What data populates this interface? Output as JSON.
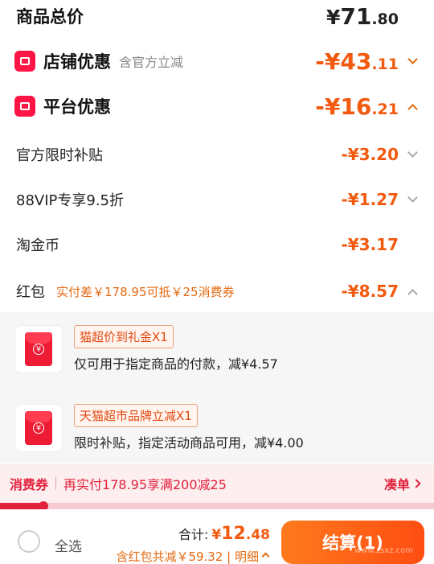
{
  "summary": {
    "total_label": "商品总价",
    "total_currency": "¥",
    "total_int": "71",
    "total_dec": ".80"
  },
  "store_discount": {
    "label": "店铺优惠",
    "sub": "含官方立减",
    "amount_int": "-¥43",
    "amount_dec": ".11"
  },
  "platform_discount": {
    "label": "平台优惠",
    "amount_int": "-¥16",
    "amount_dec": ".21"
  },
  "items": [
    {
      "label": "官方限时补贴",
      "amount": "-¥3.20"
    },
    {
      "label": "88VIP专享9.5折",
      "amount": "-¥1.27"
    },
    {
      "label": "淘金币",
      "amount": "-¥3.17"
    }
  ],
  "red_packet": {
    "label": "红包",
    "hint": "实付差￥178.95可抵￥25消费券",
    "amount": "-¥8.57"
  },
  "coupons": [
    {
      "tag": "猫超价到礼金X1",
      "desc": "仅可用于指定商品的付款，减¥4.57"
    },
    {
      "tag": "天猫超市品牌立减X1",
      "desc": "限时补贴，指定活动商品可用，减¥4.00"
    }
  ],
  "voucher_strip": {
    "label": "消费券",
    "text": "再实付178.95享满200减25",
    "link": "凑单",
    "progress": 0.1
  },
  "bottom_bar": {
    "select_all": "全选",
    "total_label": "合计:",
    "currency": "¥",
    "total_int": "12",
    "total_dec": ".48",
    "savings": "含红包共减￥59.32 | 明细",
    "checkout": "结算(1)",
    "watermark": "www.zsxz.com"
  },
  "colors": {
    "accent": "#f25a0f",
    "red": "#e2213b",
    "badge": "#ff1446"
  }
}
